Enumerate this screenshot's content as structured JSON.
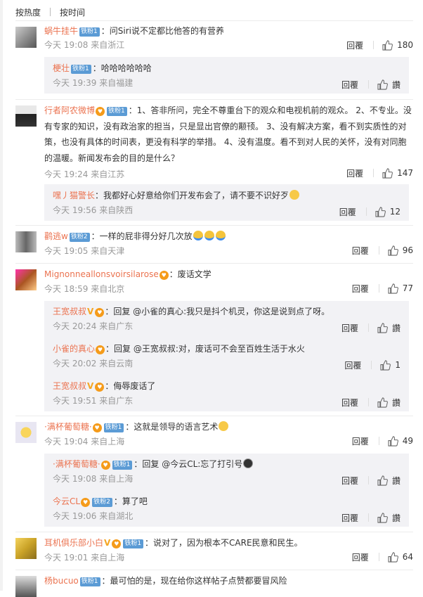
{
  "sort": {
    "hot": "按热度",
    "time": "按时间"
  },
  "ui": {
    "reply": "回覆",
    "like": "讚"
  },
  "comments": [
    {
      "user": "蜗牛挂牛",
      "tag": "铁粉1",
      "text": "：问Siri说不定都比他答的有营养",
      "meta": "今天 19:08 来自浙江",
      "likes": "180",
      "replies": [
        {
          "user": "梗壮",
          "tag": "铁粉1",
          "text": "：哈哈哈哈哈哈",
          "meta": "今天 19:39 来自福建",
          "likes": ""
        }
      ]
    },
    {
      "user": "行者阿农微博",
      "tag": "铁粉1",
      "text": "：1、答非所问，完全不尊重台下的观众和电视机前的观众。 2、不专业。没有专家的知识，没有政治家的担当，只是显出官僚的颟顸。 3、没有解决方案，看不到实质性的对策，也没有具体的时间表，更没有科学的举措。 4、没有温度。看不到对人民的关怀，没有对同胞的温暖。新闻发布会的目的是什么？",
      "meta": "今天 19:24 来自江苏",
      "likes": "147",
      "replies": [
        {
          "user": "嘿丿猫警长",
          "tag": "",
          "text": "：我都好心好意给你们开发布会了，请不要不识好歹",
          "meta": "今天 19:56 来自陕西",
          "likes": "12"
        }
      ]
    },
    {
      "user": "鹳逃w",
      "tag": "铁粉2",
      "text": "：一样的屁非得分好几次放",
      "meta": "今天 19:05 来自天津",
      "likes": "96",
      "replies": []
    },
    {
      "user": "Mignonneallonsvoirsilarose",
      "tag": "",
      "text": "：废话文学",
      "meta": "今天 18:59 来自北京",
      "likes": "77",
      "replies": [
        {
          "user": "王宽叔叔",
          "tag": "",
          "text": "：回复 @小雀的真心:我只是抖个机灵，你这是说到点了呀。",
          "meta": "今天 20:24 来自广东",
          "likes": ""
        },
        {
          "user": "小雀的真心",
          "tag": "",
          "text": "：回复 @王宽叔叔:对，废话可不会至百姓生活于水火",
          "meta": "今天 20:02 来自云南",
          "likes": "1"
        },
        {
          "user": "王宽叔叔",
          "tag": "",
          "text": "：侮辱废话了",
          "meta": "今天 19:51 来自广东",
          "likes": ""
        }
      ]
    },
    {
      "user": "·满杯葡萄糖·",
      "tag": "铁粉1",
      "text": "：这就是领导的语言艺术",
      "meta": "今天 19:04 来自上海",
      "likes": "49",
      "replies": [
        {
          "user": "·满杯葡萄糖·",
          "tag": "铁粉1",
          "text": "：回复 @今云CL:忘了打引号",
          "meta": "今天 19:08 来自上海",
          "likes": ""
        },
        {
          "user": "今云CL",
          "tag": "铁粉2",
          "text": "：算了吧",
          "meta": "今天 19:06 来自湖北",
          "likes": ""
        }
      ]
    },
    {
      "user": "耳机俱乐部小白",
      "tag": "铁粉1",
      "text": "：说对了，因为根本不CARE民意和民生。",
      "meta": "今天 19:01 来自上海",
      "likes": "64",
      "replies": []
    },
    {
      "user": "杨bucuo",
      "tag": "铁粉1",
      "text": "：最可怕的是，现在给你这样帖子点赞都要冒风险",
      "meta": "",
      "likes": "",
      "replies": []
    }
  ]
}
